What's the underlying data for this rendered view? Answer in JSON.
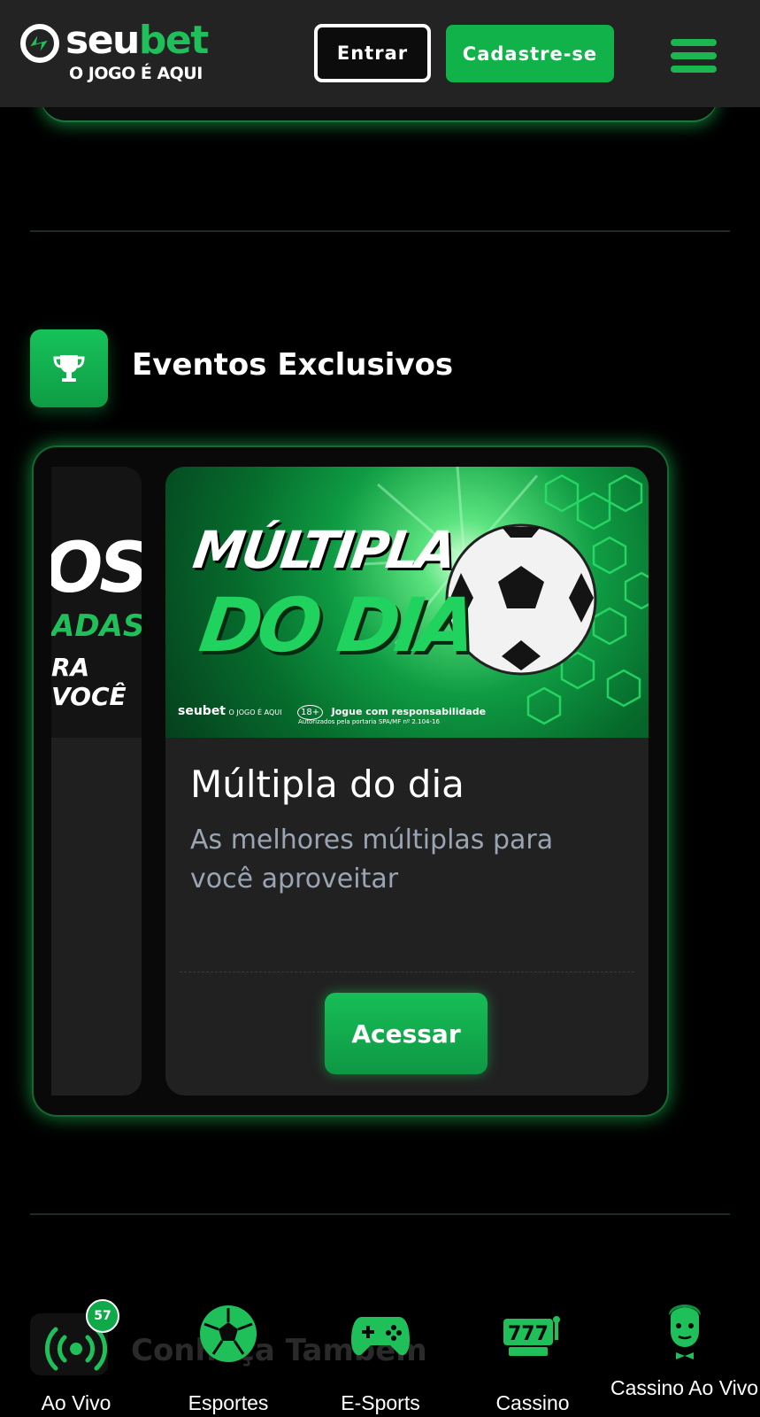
{
  "header": {
    "logo_seu": "seu",
    "logo_bet": "bet",
    "logo_tagline": "O JOGO É AQUI",
    "login_label": "Entrar",
    "signup_label": "Cadastre-se"
  },
  "section": {
    "title": "Eventos Exclusivos"
  },
  "carousel": {
    "partial_card": {
      "line1": "OS",
      "line2": "ADAS",
      "line3": "RA VOCÊ"
    },
    "card": {
      "banner_line1": "MÚLTIPLA",
      "banner_line2": "DO DIA",
      "banner_brand": "seubet",
      "banner_brand_tag": "O JOGO É AQUI",
      "banner_age": "18+",
      "banner_responsible": "Jogue com responsabilidade",
      "banner_authorized": "Autorizados pela portaria SPA/MF nº 2.104-16",
      "title": "Múltipla do dia",
      "description": "As melhores múltiplas para você aproveitar",
      "button_label": "Acessar"
    }
  },
  "next_section": {
    "title": "Conheça Também"
  },
  "bottom_nav": {
    "items": [
      {
        "label": "Ao Vivo",
        "icon": "live-signal-icon",
        "badge": "57"
      },
      {
        "label": "Esportes",
        "icon": "soccer-ball-icon"
      },
      {
        "label": "E-Sports",
        "icon": "gamepad-icon"
      },
      {
        "label": "Cassino",
        "icon": "slot-machine-icon"
      },
      {
        "label": "Cassino Ao Vivo",
        "icon": "dealer-icon"
      }
    ]
  },
  "colors": {
    "brand_green": "#12b24a",
    "header_bg": "#232323",
    "page_bg": "#000000",
    "card_bg": "#212121",
    "muted_text": "#9aa5b4"
  }
}
